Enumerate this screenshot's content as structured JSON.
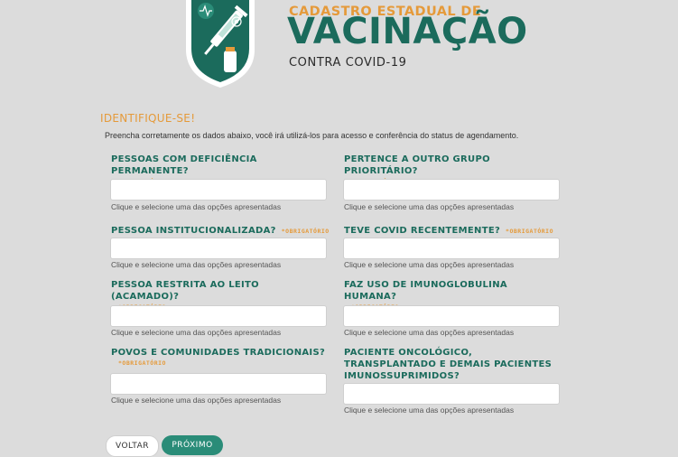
{
  "header": {
    "title_small": "CADASTRO ESTADUAL DE",
    "title_big": "VACINAÇÃO",
    "title_sub": "CONTRA COVID-19"
  },
  "section": {
    "title": "IDENTIFIQUE-SE!",
    "description": "Preencha corretamente os dados abaixo, você irá utilizá-los para acesso e conferência do status de agendamento."
  },
  "required_label": "*OBRIGATÓRIO",
  "hint": "Clique e selecione uma das opções apresentadas",
  "fields": [
    {
      "label": "PESSOAS COM DEFICIÊNCIA PERMANENTE?",
      "value": ""
    },
    {
      "label": "PERTENCE A OUTRO GRUPO PRIORITÁRIO?",
      "value": ""
    },
    {
      "label": "PESSOA INSTITUCIONALIZADA?",
      "value": ""
    },
    {
      "label": "TEVE COVID RECENTEMENTE?",
      "value": ""
    },
    {
      "label": "PESSOA RESTRITA AO LEITO (ACAMADO)?",
      "value": ""
    },
    {
      "label": "FAZ USO DE IMUNOGLOBULINA HUMANA?",
      "value": ""
    },
    {
      "label": "POVOS E COMUNIDADES TRADICIONAIS?",
      "value": ""
    },
    {
      "label": "PACIENTE ONCOLÓGICO, TRANSPLANTADO E DEMAIS PACIENTES IMUNOSSUPRIMIDOS?",
      "value": ""
    }
  ],
  "buttons": {
    "back": "VOLTAR",
    "next": "PRÓXIMO"
  },
  "colors": {
    "brand_green": "#1b6b5c",
    "accent_orange": "#e59a3a",
    "button_green": "#2a8c78"
  }
}
